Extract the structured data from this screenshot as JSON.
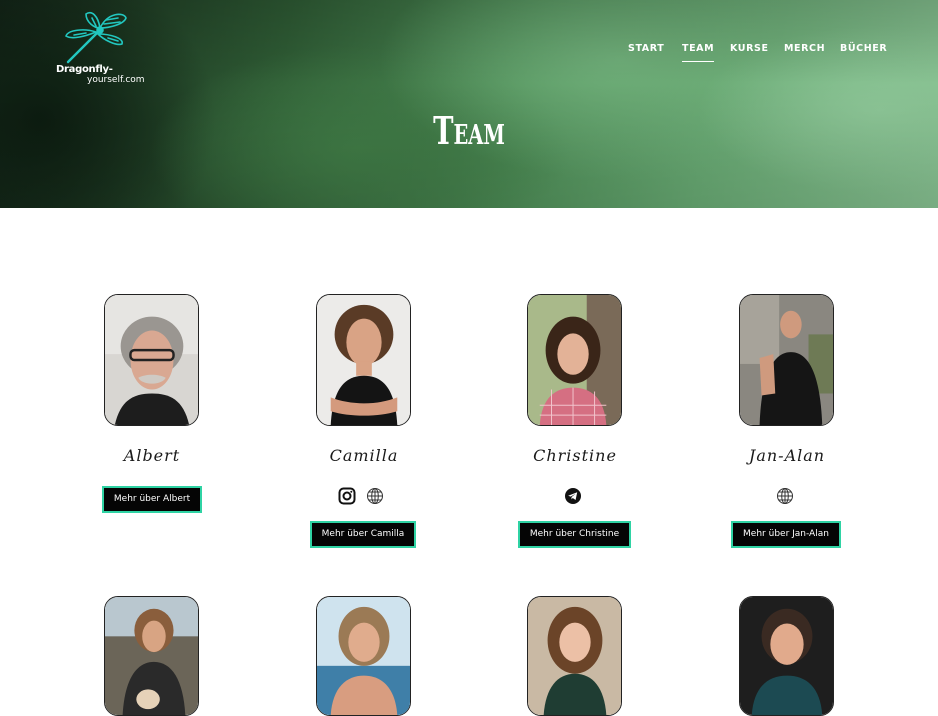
{
  "site": {
    "logo_line1": "Dragonfly-",
    "logo_line2": "yourself.com"
  },
  "nav": {
    "items": [
      "START",
      "TEAM",
      "KURSE",
      "MERCH",
      "BÜCHER"
    ],
    "active": "TEAM"
  },
  "hero": {
    "title": "Team"
  },
  "colors": {
    "button_bg": "#050505",
    "button_border": "#2fd3a4",
    "hero_green": "#4c8b55"
  },
  "team": [
    {
      "name": "Albert",
      "button": "Mehr über Albert",
      "icons": []
    },
    {
      "name": "Camilla",
      "button": "Mehr über Camilla",
      "icons": [
        "instagram-icon",
        "globe-icon"
      ]
    },
    {
      "name": "Christine",
      "button": "Mehr über Christine",
      "icons": [
        "telegram-icon"
      ]
    },
    {
      "name": "Jan-Alan",
      "button": "Mehr über Jan-Alan",
      "icons": [
        "globe-icon"
      ]
    }
  ]
}
